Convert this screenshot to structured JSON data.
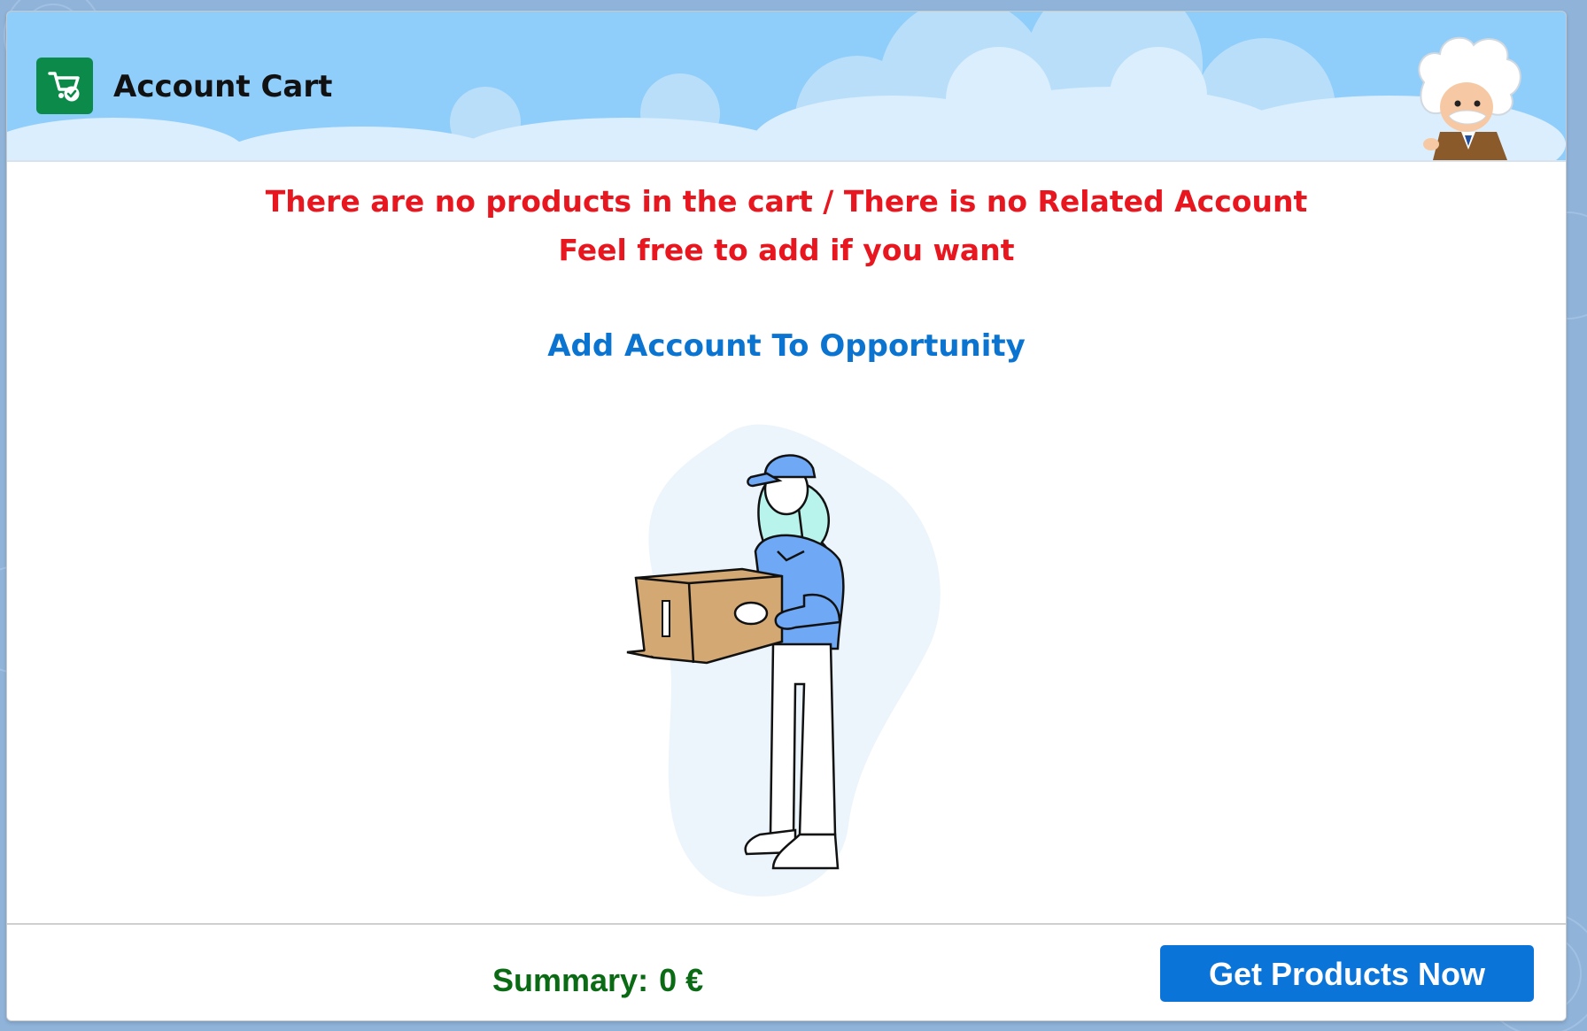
{
  "header": {
    "title": "Account Cart",
    "app_icon": "cart-check-icon",
    "mascot": "einstein-mascot"
  },
  "messages": {
    "line1": "There are no products in the cart / There is no Related Account",
    "line2": "Feel free to add if you want"
  },
  "actions": {
    "add_account_link": "Add Account To Opportunity",
    "get_products_button": "Get Products Now"
  },
  "illustration": "person-holding-box",
  "footer": {
    "summary_label": "Summary:",
    "summary_value": "0 €",
    "summary_color": "#0a6b14"
  },
  "colors": {
    "error_text": "#e8161e",
    "link": "#0a74d0",
    "button": "#0a74d8",
    "header_sky": "#8fcdfb",
    "app_icon_bg": "#0b8a4a"
  }
}
